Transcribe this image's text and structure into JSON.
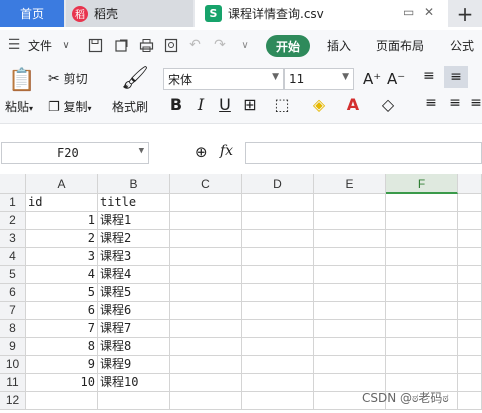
{
  "tabs": {
    "home": "首页",
    "docer": "稻壳",
    "file": "课程详情查询.csv"
  },
  "menu": {
    "file": "文件",
    "start": "开始",
    "insert": "插入",
    "layout": "页面布局",
    "formula": "公式"
  },
  "ribbon": {
    "paste": "粘贴",
    "cut": "剪切",
    "copy": "复制",
    "format_painter": "格式刷",
    "font_name": "宋体",
    "font_size": "11"
  },
  "formula_bar": {
    "cell_ref": "F20",
    "fx_label": "fx"
  },
  "sheet": {
    "columns": [
      "A",
      "B",
      "C",
      "D",
      "E",
      "F"
    ],
    "active_column": "F",
    "rows": [
      {
        "n": "1",
        "a": "id",
        "b": "title"
      },
      {
        "n": "2",
        "a": "1",
        "b": "课程1"
      },
      {
        "n": "3",
        "a": "2",
        "b": "课程2"
      },
      {
        "n": "4",
        "a": "3",
        "b": "课程3"
      },
      {
        "n": "5",
        "a": "4",
        "b": "课程4"
      },
      {
        "n": "6",
        "a": "5",
        "b": "课程5"
      },
      {
        "n": "7",
        "a": "6",
        "b": "课程6"
      },
      {
        "n": "8",
        "a": "7",
        "b": "课程7"
      },
      {
        "n": "9",
        "a": "8",
        "b": "课程8"
      },
      {
        "n": "10",
        "a": "9",
        "b": "课程9"
      },
      {
        "n": "11",
        "a": "10",
        "b": "课程10"
      },
      {
        "n": "12",
        "a": "",
        "b": ""
      }
    ]
  },
  "watermark": "CSDN @ಠ老码ಠ"
}
